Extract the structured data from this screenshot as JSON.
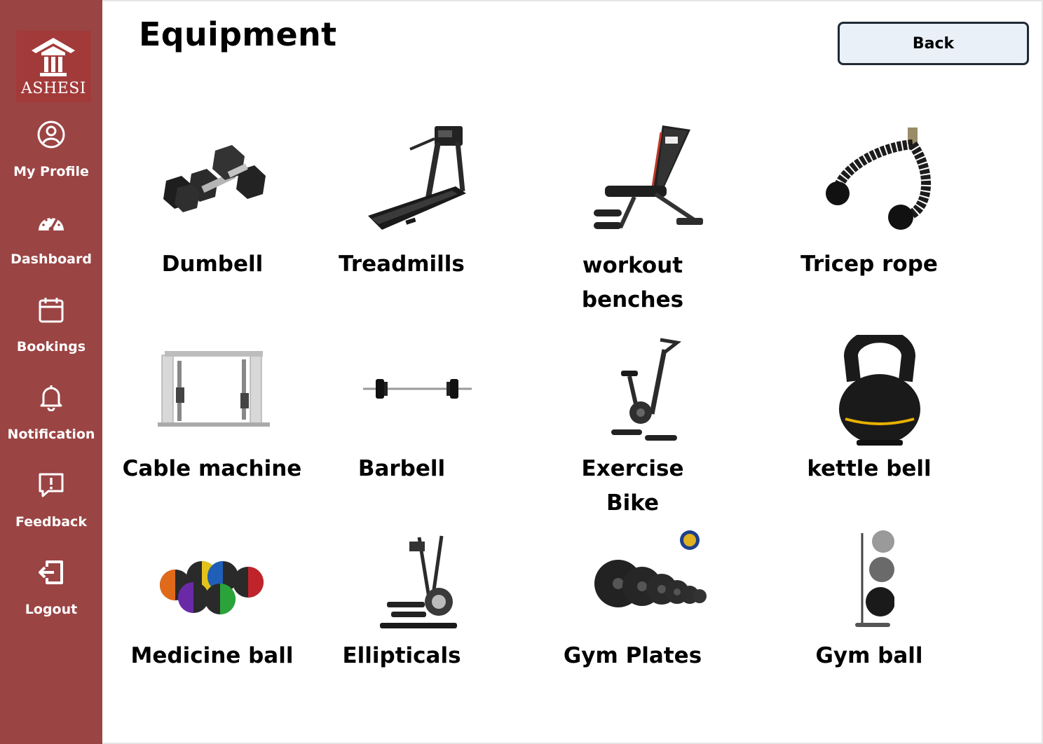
{
  "brand": {
    "logo_text": "ASHESI",
    "color": "#9b4444"
  },
  "sidebar": {
    "items": [
      {
        "label": "My Profile",
        "icon": "user-circle-icon"
      },
      {
        "label": "Dashboard",
        "icon": "speedometer-icon"
      },
      {
        "label": "Bookings",
        "icon": "calendar-icon"
      },
      {
        "label": "Notification",
        "icon": "bell-icon"
      },
      {
        "label": "Feedback",
        "icon": "feedback-icon"
      },
      {
        "label": "Logout",
        "icon": "logout-icon"
      }
    ]
  },
  "header": {
    "title": "Equipment",
    "back_label": "Back"
  },
  "equipment": [
    {
      "name": "Dumbell",
      "icon": "dumbbell-icon"
    },
    {
      "name": "Treadmills",
      "icon": "treadmill-icon"
    },
    {
      "name": "workout benches",
      "icon": "bench-icon"
    },
    {
      "name": "Tricep rope",
      "icon": "rope-icon"
    },
    {
      "name": "Cable machine",
      "icon": "cable-machine-icon"
    },
    {
      "name": "Barbell",
      "icon": "barbell-icon"
    },
    {
      "name": "Exercise Bike",
      "icon": "bike-icon"
    },
    {
      "name": "kettle bell",
      "icon": "kettlebell-icon"
    },
    {
      "name": "Medicine ball",
      "icon": "medicine-ball-icon"
    },
    {
      "name": "Ellipticals",
      "icon": "elliptical-icon"
    },
    {
      "name": "Gym Plates",
      "icon": "plates-icon"
    },
    {
      "name": "Gym ball",
      "icon": "gym-ball-icon"
    }
  ]
}
